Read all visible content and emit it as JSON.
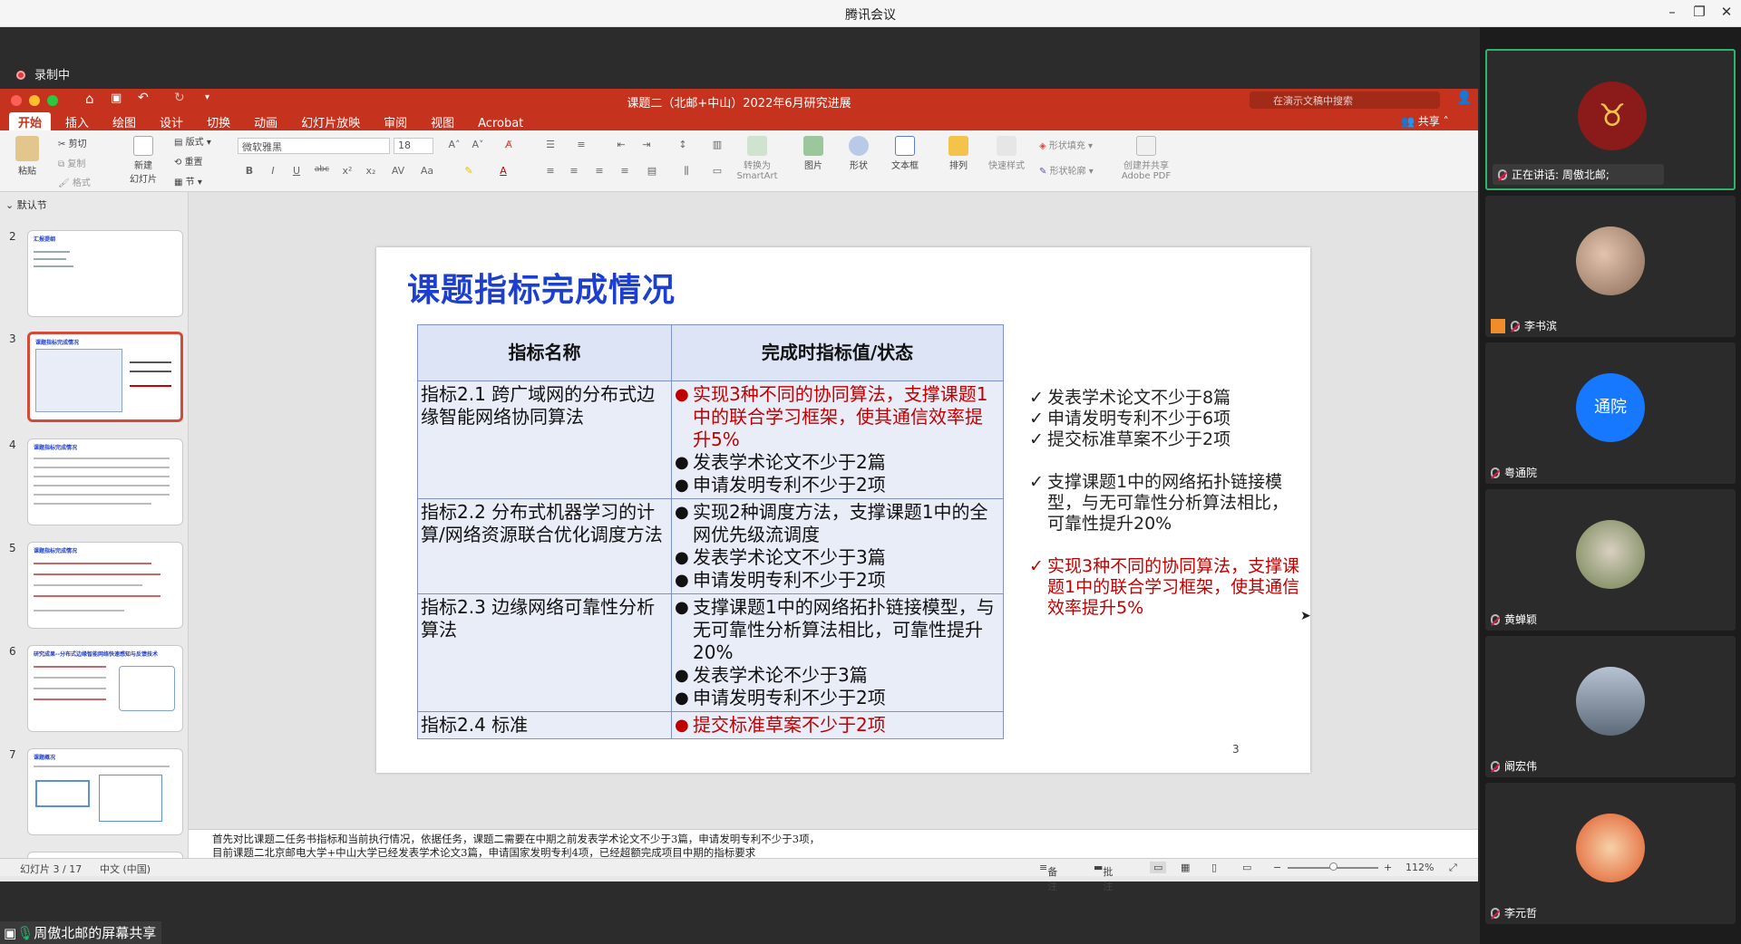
{
  "window": {
    "title": "腾讯会议"
  },
  "meeting": {
    "recording_label": "录制中",
    "share_label": "周傲北邮的屏幕共享"
  },
  "ppt": {
    "doc_title": "课题二（北邮+中山）2022年6月研究进展",
    "search_placeholder": "在演示文稿中搜索",
    "share_label": "共享",
    "tabs": [
      "开始",
      "插入",
      "绘图",
      "设计",
      "切换",
      "动画",
      "幻灯片放映",
      "审阅",
      "视图",
      "Acrobat"
    ],
    "ribbon": {
      "paste": "粘贴",
      "cut": "剪切",
      "copy": "复制",
      "format": "格式",
      "new_slide": "新建\n幻灯片",
      "layout": "版式",
      "reset": "重置",
      "section": "节",
      "font_name": "微软雅黑",
      "font_size": "18",
      "convert_smartart": "转换为\nSmartArt",
      "picture": "图片",
      "shape": "形状",
      "textbox": "文本框",
      "arrange": "排列",
      "quick_styles": "快速样式",
      "shape_fill": "形状填充",
      "shape_outline": "形状轮廓",
      "create_pdf": "创建并共享\nAdobe PDF"
    },
    "section_label": "默认节",
    "thumbnails": [
      {
        "num": "2",
        "title": "汇报提纲"
      },
      {
        "num": "3",
        "title": "课题指标完成情况"
      },
      {
        "num": "4",
        "title": "课题指标完成情况"
      },
      {
        "num": "5",
        "title": "课题指标完成情况"
      },
      {
        "num": "6",
        "title": "研究成果--分布式边缘智能网络快速感知与反馈技术"
      },
      {
        "num": "7",
        "title": "课题概况"
      }
    ],
    "slide": {
      "title": "课题指标完成情况",
      "table_headers": [
        "指标名称",
        "完成时指标值/状态"
      ],
      "rows": [
        {
          "name": "指标2.1 跨广域网的分布式边缘智能网络协同算法",
          "items": [
            "实现3种不同的协同算法，支撑课题1中的联合学习框架，使其通信效率提升5%",
            "发表学术论文不少于2篇",
            "申请发明专利不少于2项"
          ]
        },
        {
          "name": "指标2.2 分布式机器学习的计算/网络资源联合优化调度方法",
          "items": [
            "实现2种调度方法，支撑课题1中的全网优先级流调度",
            "发表学术论文不少于3篇",
            "申请发明专利不少于2项"
          ]
        },
        {
          "name": "指标2.3 边缘网络可靠性分析算法",
          "items": [
            "支撑课题1中的网络拓扑链接模型，与无可靠性分析算法相比，可靠性提升20%",
            "发表学术论不少于3篇",
            "申请发明专利不少于2项"
          ]
        },
        {
          "name": "指标2.4 标准",
          "items": [
            "提交标准草案不少于2项"
          ]
        }
      ],
      "checks_group1": [
        "发表学术论文不少于8篇",
        "申请发明专利不少于6项",
        "提交标准草案不少于2项"
      ],
      "checks_group2": [
        "支撑课题1中的网络拓扑链接模型，与无可靠性分析算法相比，可靠性提升20%"
      ],
      "checks_group3": [
        "实现3种不同的协同算法，支撑课题1中的联合学习框架，使其通信效率提升5%"
      ],
      "page_number": "3"
    },
    "notes": [
      "首先对比课题二任务书指标和当前执行情况，依据任务，课题二需要在中期之前发表学术论文不少于3篇，申请发明专利不少于3项，",
      "目前课题二北京邮电大学+中山大学已经发表学术论文3篇，申请国家发明专利4项，已经超额完成项目中期的指标要求"
    ],
    "status": {
      "slide_counter": "幻灯片 3 / 17",
      "language": "中文 (中国)",
      "notes_btn": "备注",
      "comments_btn": "批注",
      "zoom": "112%"
    }
  },
  "participants": [
    {
      "name": "正在讲话: 周傲北邮;",
      "avatar_type": "bull-icon",
      "avatar_color": "#8b1a1a"
    },
    {
      "name": "李书滨",
      "avatar_type": "photo",
      "avatar_color": "#b99a86"
    },
    {
      "name": "粤通院",
      "avatar_text": "通院",
      "avatar_color": "#1677ff"
    },
    {
      "name": "黄蝉颖",
      "avatar_type": "photo",
      "avatar_color": "#8aa06a"
    },
    {
      "name": "阚宏伟",
      "avatar_type": "photo",
      "avatar_color": "#6d7f96"
    },
    {
      "name": "李元哲",
      "avatar_type": "cartoon",
      "avatar_color": "#e05a2a"
    }
  ]
}
